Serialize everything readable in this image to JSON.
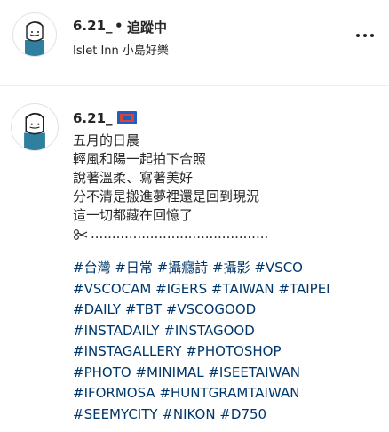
{
  "header": {
    "username": "6.21_",
    "dot": "•",
    "follow_label": "追蹤中",
    "location": "Islet Inn 小島好樂",
    "more_icon": "more-horizontal-icon"
  },
  "caption": {
    "username": "6.21_",
    "flag_icon": "flag-icon",
    "lines": [
      "五月的日晨",
      "輕風和陽一起拍下合照",
      "說著溫柔、寫著美好",
      "分不清是搬進夢裡還是回到現況",
      "這一切都藏在回憶了"
    ],
    "separator_dots": "..........................................",
    "scissors_icon": "scissors-icon",
    "hashtag_lines": [
      "#台灣 #日常 #攝癮詩 #攝影 #VSCO",
      "#VSCOCAM #IGERS #TAIWAN #TAIPEI",
      "#DAILY #TBT #VSCOGOOD",
      "#INSTADAILY #INSTAGOOD",
      "#INSTAGALLERY #PHOTOSHOP",
      "#PHOTO #MINIMAL #ISEETAIWAN",
      "#IFORMOSA #HUNTGRAMTAIWAN",
      "#SEEMYCITY #NIKON #D750"
    ]
  },
  "colors": {
    "text": "#262626",
    "hashtag": "#00376b",
    "divider": "#efefef"
  }
}
